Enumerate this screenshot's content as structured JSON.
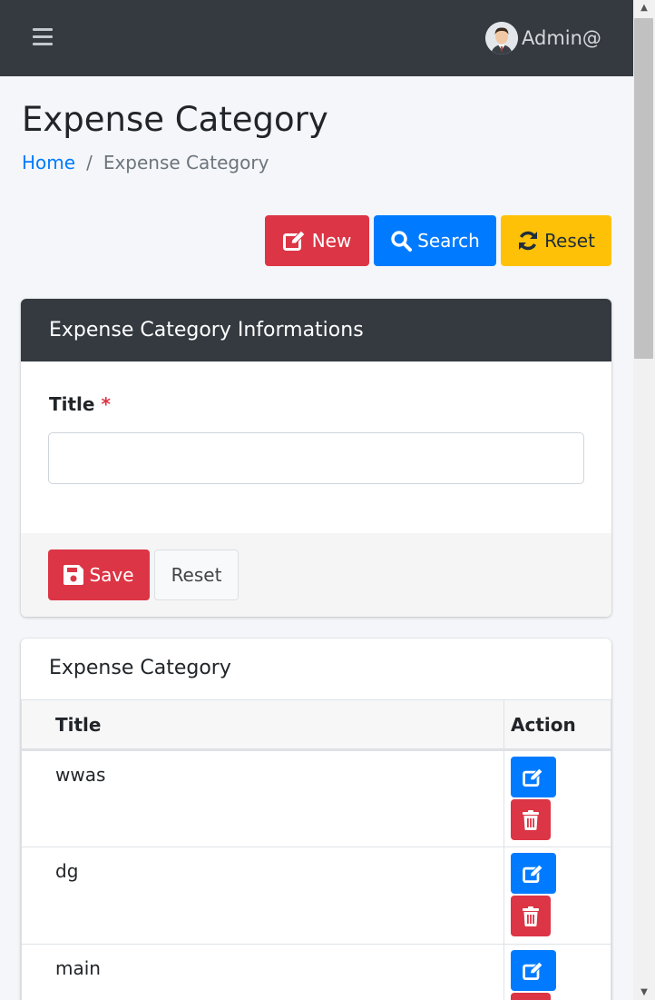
{
  "navbar": {
    "menu_icon": "hamburger-icon",
    "user_name": "Admin@",
    "avatar_icon": "user-avatar"
  },
  "page": {
    "title": "Expense Category",
    "breadcrumb": {
      "home": "Home",
      "separator": "/",
      "current": "Expense Category"
    }
  },
  "toolbar": {
    "new_label": "New",
    "search_label": "Search",
    "reset_label": "Reset",
    "new_icon": "edit-icon",
    "search_icon": "search-icon",
    "reset_icon": "refresh-icon"
  },
  "form_card": {
    "header": "Expense Category Informations",
    "title_label": "Title",
    "required_mark": "*",
    "title_value": "",
    "title_placeholder": "",
    "save_label": "Save",
    "save_icon": "floppy-icon",
    "reset_label": "Reset"
  },
  "list_card": {
    "title": "Expense Category",
    "columns": [
      "Title",
      "Action"
    ],
    "rows": [
      {
        "title": "wwas"
      },
      {
        "title": "dg"
      },
      {
        "title": "main"
      }
    ]
  },
  "colors": {
    "navbar": "#343a40",
    "danger": "#dc3545",
    "primary": "#007bff",
    "warning": "#ffc107",
    "background": "#f4f6f9"
  }
}
